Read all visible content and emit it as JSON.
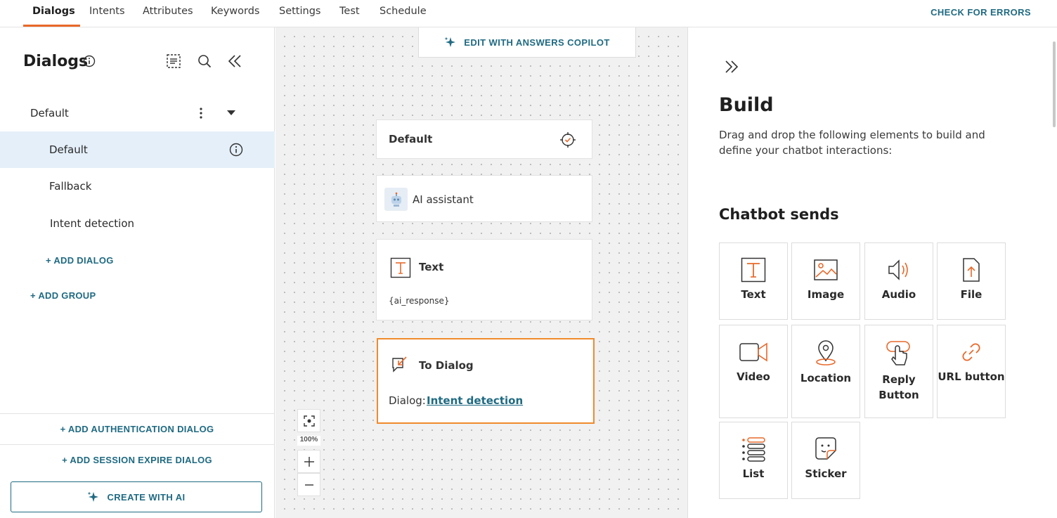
{
  "nav": {
    "tabs": [
      {
        "label": "Dialogs",
        "active": true
      },
      {
        "label": "Intents"
      },
      {
        "label": "Attributes"
      },
      {
        "label": "Keywords"
      },
      {
        "label": "Settings"
      },
      {
        "label": "Test"
      },
      {
        "label": "Schedule"
      }
    ],
    "check_errors": "CHECK FOR ERRORS"
  },
  "sidebar": {
    "title": "Dialogs",
    "group": {
      "label": "Default"
    },
    "dialogs": [
      {
        "label": "Default",
        "selected": true
      },
      {
        "label": "Fallback"
      },
      {
        "label": "Intent detection"
      }
    ],
    "add_dialog": "+ ADD DIALOG",
    "add_group": "+ ADD GROUP",
    "add_auth_dialog": "+ ADD AUTHENTICATION DIALOG",
    "add_session_dialog": "+ ADD SESSION EXPIRE DIALOG",
    "create_ai": "CREATE WITH AI"
  },
  "canvas": {
    "copilot": "EDIT WITH ANSWERS COPILOT",
    "nodes": {
      "default_title": "Default",
      "ai_title": "AI assistant",
      "text_title": "Text",
      "text_body": "{ai_response}",
      "todialog_title": "To Dialog",
      "todialog_prefix": "Dialog: ",
      "todialog_link": "Intent detection"
    },
    "zoom": "100%"
  },
  "build": {
    "title": "Build",
    "description": "Drag and drop the following elements to build and define your chatbot interactions:",
    "section_title": "Chatbot sends",
    "elements": [
      {
        "label": "Text",
        "icon": "text-icon"
      },
      {
        "label": "Image",
        "icon": "image-icon"
      },
      {
        "label": "Audio",
        "icon": "audio-icon"
      },
      {
        "label": "File",
        "icon": "file-icon"
      },
      {
        "label": "Video",
        "icon": "video-icon"
      },
      {
        "label": "Location",
        "icon": "location-icon"
      },
      {
        "label": "Reply Button",
        "icon": "reply-button-icon"
      },
      {
        "label": "URL button",
        "icon": "url-button-icon"
      },
      {
        "label": "List",
        "icon": "list-icon"
      },
      {
        "label": "Sticker",
        "icon": "sticker-icon"
      }
    ]
  },
  "colors": {
    "accent": "#1f6a82",
    "orange": "#e8692a",
    "selected_bg": "#e4eff9"
  }
}
